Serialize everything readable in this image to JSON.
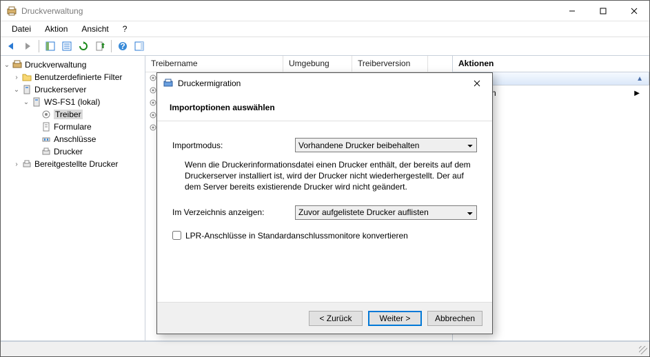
{
  "window": {
    "title": "Druckverwaltung"
  },
  "menu": {
    "file": "Datei",
    "action": "Aktion",
    "view": "Ansicht",
    "help": "?"
  },
  "tree": {
    "root": "Druckverwaltung",
    "custom_filters": "Benutzerdefinierte Filter",
    "print_servers": "Druckerserver",
    "server": "WS-FS1 (lokal)",
    "drivers": "Treiber",
    "forms": "Formulare",
    "ports": "Anschlüsse",
    "printers": "Drucker",
    "deployed": "Bereitgestellte Drucker"
  },
  "columns": {
    "driver_name": "Treibername",
    "environment": "Umgebung",
    "driver_version": "Treiberversion"
  },
  "actions": {
    "header": "Aktionen",
    "more": "tionen"
  },
  "dialog": {
    "title": "Druckermigration",
    "heading": "Importoptionen auswählen",
    "mode_label": "Importmodus:",
    "mode_value": "Vorhandene Drucker beibehalten",
    "mode_description": "Wenn die Druckerinformationsdatei einen Drucker enthält, der bereits auf dem Druckerserver installiert ist, wird der Drucker nicht wiederhergestellt. Der auf dem Server bereits existierende Drucker wird nicht geändert.",
    "dir_label": "Im Verzeichnis anzeigen:",
    "dir_value": "Zuvor aufgelistete Drucker auflisten",
    "lpr_label": "LPR-Anschlüsse in Standardanschlussmonitore konvertieren",
    "back": "< Zurück",
    "next": "Weiter >",
    "cancel": "Abbrechen"
  }
}
